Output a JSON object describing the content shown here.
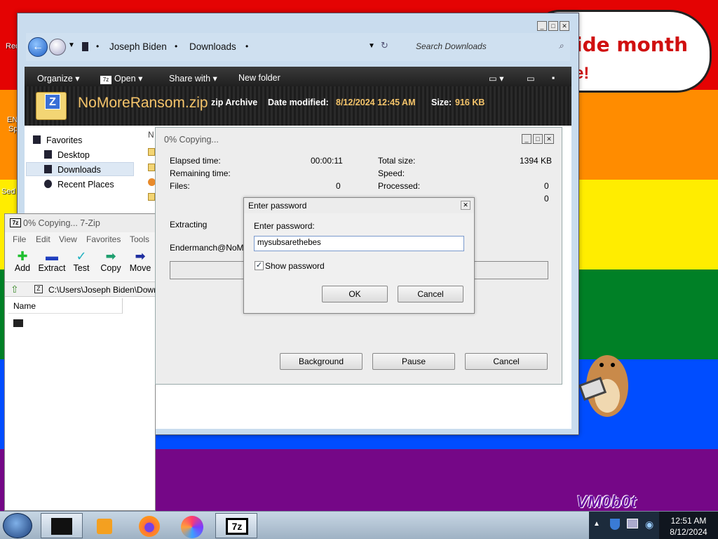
{
  "desktop": {
    "icons": [
      {
        "label": "Rec"
      },
      {
        "label": "EN"
      },
      {
        "label": "Sp"
      },
      {
        "label": "Sed"
      }
    ],
    "bubble_line1": "ide month",
    "bubble_line2": "e!",
    "watermark": "VM0b0t"
  },
  "explorer": {
    "breadcrumb": [
      "Joseph Biden",
      "Downloads"
    ],
    "search_placeholder": "Search Downloads",
    "toolbar": {
      "organize": "Organize",
      "open": "Open",
      "share": "Share with",
      "new_folder": "New folder"
    },
    "file": {
      "name": "NoMoreRansom.zip",
      "type": "zip Archive",
      "date_label": "Date modified:",
      "date": "8/12/2024 12:45 AM",
      "size_label": "Size:",
      "size": "916 KB"
    },
    "nav": {
      "favorites": "Favorites",
      "desktop": "Desktop",
      "downloads": "Downloads",
      "recent": "Recent Places"
    },
    "col_header_partial": "N"
  },
  "copy_dialog": {
    "title": "0% Copying...",
    "elapsed_label": "Elapsed time:",
    "elapsed": "00:00:11",
    "remaining_label": "Remaining time:",
    "files_label": "Files:",
    "files": "0",
    "total_label": "Total size:",
    "total": "1394 KB",
    "speed_label": "Speed:",
    "processed_label": "Processed:",
    "processed": "0",
    "row4_value": "0",
    "extracting_label": "Extracting",
    "current_file": "Endermanch@NoMore",
    "progress_fraction": 0,
    "buttons": {
      "background": "Background",
      "pause": "Pause",
      "cancel": "Cancel"
    }
  },
  "zip_window": {
    "title": "0% Copying... 7-Zip",
    "menu": [
      "File",
      "Edit",
      "View",
      "Favorites",
      "Tools"
    ],
    "tools": [
      {
        "label": "Add"
      },
      {
        "label": "Extract"
      },
      {
        "label": "Test"
      },
      {
        "label": "Copy"
      },
      {
        "label": "Move"
      }
    ],
    "path": "C:\\Users\\Joseph Biden\\Down",
    "col_name": "Name"
  },
  "password_dialog": {
    "title": "Enter password",
    "label": "Enter password:",
    "value": "mysubsarethebes",
    "show_password_label": "Show password",
    "show_password_checked": true,
    "ok": "OK",
    "cancel": "Cancel"
  },
  "taskbar": {
    "time": "12:51 AM",
    "date": "8/12/2024"
  }
}
